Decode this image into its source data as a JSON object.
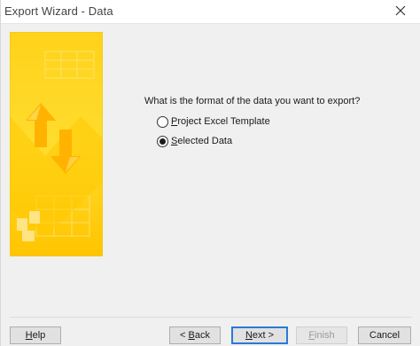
{
  "window": {
    "title": "Export Wizard - Data"
  },
  "icons": {
    "close": "close-icon",
    "banner": "wizard-banner-graphic"
  },
  "colors": {
    "banner_yellow": "#ffd200",
    "banner_light": "#ffe96b",
    "accent_blue": "#2a7ad5"
  },
  "content": {
    "prompt": "What is the format of the data you want to export?",
    "options": [
      {
        "label_prefix": "",
        "label_mnemonic": "P",
        "label_rest": "roject Excel Template",
        "selected": false
      },
      {
        "label_prefix": "",
        "label_mnemonic": "S",
        "label_rest": "elected Data",
        "selected": true
      }
    ]
  },
  "buttons": {
    "help": {
      "mnemonic": "H",
      "rest": "elp"
    },
    "back": {
      "prefix": "< ",
      "mnemonic": "B",
      "rest": "ack"
    },
    "next": {
      "mnemonic": "N",
      "rest": "ext >"
    },
    "finish": {
      "mnemonic": "F",
      "rest": "inish",
      "disabled": true
    },
    "cancel": {
      "label": "Cancel"
    }
  }
}
